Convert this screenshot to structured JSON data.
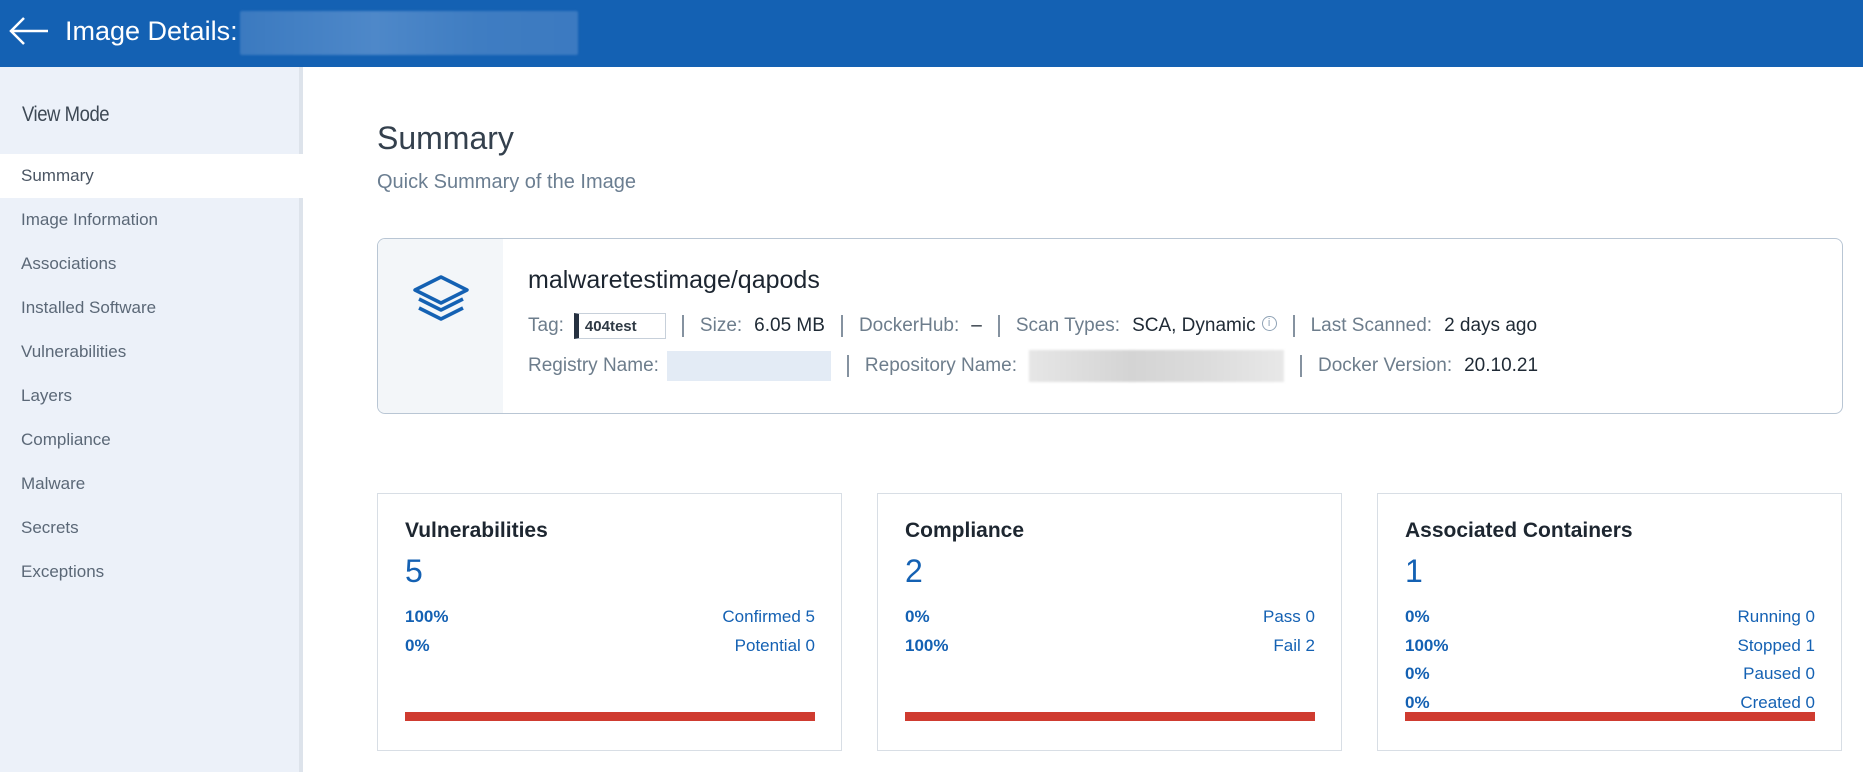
{
  "header": {
    "title": "Image Details:"
  },
  "sidebar": {
    "heading": "View Mode",
    "items": [
      {
        "label": "Summary",
        "active": true
      },
      {
        "label": "Image Information"
      },
      {
        "label": "Associations"
      },
      {
        "label": "Installed Software"
      },
      {
        "label": "Vulnerabilities"
      },
      {
        "label": "Layers"
      },
      {
        "label": "Compliance"
      },
      {
        "label": "Malware"
      },
      {
        "label": "Secrets"
      },
      {
        "label": "Exceptions"
      }
    ]
  },
  "summary": {
    "title": "Summary",
    "subtitle": "Quick Summary of the Image"
  },
  "image": {
    "name": "malwaretestimage/qapods",
    "icon": "layers-icon",
    "tag_label": "Tag:",
    "tag": "404test",
    "size_label": "Size:",
    "size": "6.05 MB",
    "dockerhub_label": "DockerHub:",
    "dockerhub": "–",
    "scan_types_label": "Scan Types:",
    "scan_types": "SCA, Dynamic",
    "last_scanned_label": "Last Scanned:",
    "last_scanned": "2 days ago",
    "registry_label": "Registry Name:",
    "repository_label": "Repository Name:",
    "docker_version_label": "Docker Version:",
    "docker_version": "20.10.21"
  },
  "stats": {
    "vulnerabilities": {
      "title": "Vulnerabilities",
      "count": "5",
      "rows": [
        {
          "pct": "100%",
          "label": "Confirmed 5"
        },
        {
          "pct": "0%",
          "label": "Potential 0"
        }
      ]
    },
    "compliance": {
      "title": "Compliance",
      "count": "2",
      "rows": [
        {
          "pct": "0%",
          "label": "Pass 0"
        },
        {
          "pct": "100%",
          "label": "Fail 2"
        }
      ]
    },
    "containers": {
      "title": "Associated Containers",
      "count": "1",
      "rows": [
        {
          "pct": "0%",
          "label": "Running 0"
        },
        {
          "pct": "100%",
          "label": "Stopped 1"
        },
        {
          "pct": "0%",
          "label": "Paused 0"
        },
        {
          "pct": "0%",
          "label": "Created 0"
        }
      ]
    }
  },
  "colors": {
    "header": "#1461b3",
    "accent": "#1461b3",
    "bar": "#cf3b30"
  }
}
